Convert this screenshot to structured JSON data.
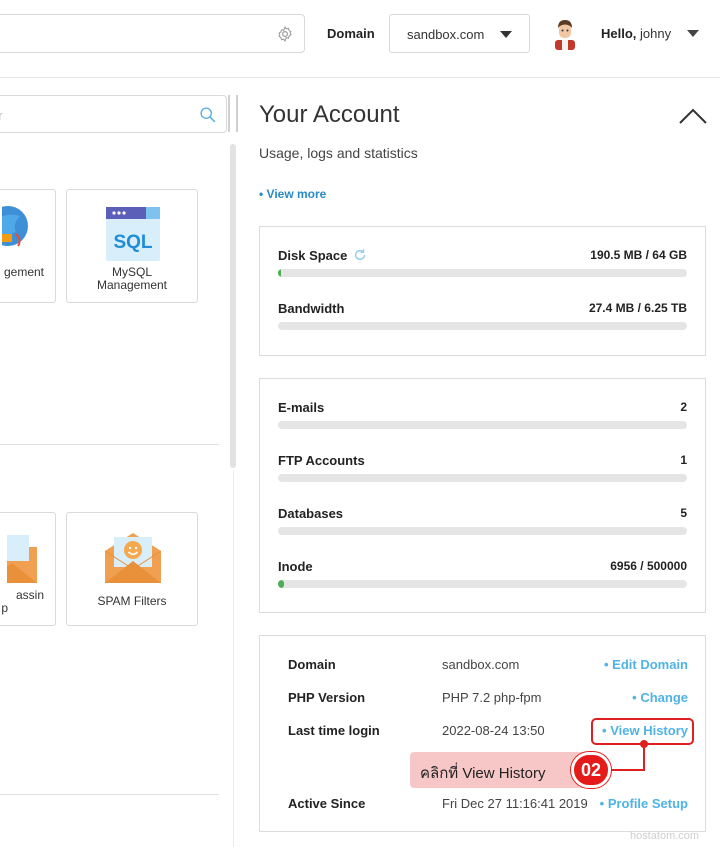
{
  "header": {
    "domain_label": "Domain",
    "domain_value": "sandbox.com",
    "hello_prefix": "Hello,",
    "username": "johny"
  },
  "left_panel": {
    "search_placeholder": "er",
    "tiles_row1": {
      "partial_label": "gement",
      "mysql_icon_text": "SQL",
      "mysql_label_line1": "MySQL",
      "mysql_label_line2": "Management"
    },
    "tiles_row2": {
      "partial_label_line1": "assin",
      "partial_label_line2": "p",
      "spam_label": "SPAM Filters"
    }
  },
  "account": {
    "title": "Your Account",
    "subtitle": "Usage, logs and statistics",
    "view_more": "• View more",
    "usage": [
      {
        "name": "Disk Space",
        "value": "190.5 MB / 64 GB",
        "fraction": 0.003
      },
      {
        "name": "Bandwidth",
        "value": "27.4 MB / 6.25 TB",
        "fraction": 0.0
      }
    ],
    "counts": [
      {
        "name": "E-mails",
        "value": "2",
        "fraction": 0.0
      },
      {
        "name": "FTP Accounts",
        "value": "1",
        "fraction": 0.0
      },
      {
        "name": "Databases",
        "value": "5",
        "fraction": 0.0
      },
      {
        "name": "Inode",
        "value": "6956 / 500000",
        "fraction": 0.014
      }
    ],
    "info": [
      {
        "key": "Domain",
        "value": "sandbox.com",
        "action": "• Edit Domain"
      },
      {
        "key": "PHP Version",
        "value": "PHP 7.2 php-fpm",
        "action": "• Change"
      },
      {
        "key": "Last time login",
        "value": "2022-08-24 13:50",
        "action": "• View History"
      },
      {
        "key": "Active Since",
        "value": "Fri Dec 27 11:16:41 2019",
        "action": "• Profile Setup"
      }
    ]
  },
  "annotation": {
    "text": "คลิกที่ View History",
    "step": "02"
  },
  "watermark": "hostatom.com",
  "colors": {
    "link": "#4fb3e6",
    "accent_red": "#e51a1a",
    "progress_fill": "#4caf50"
  }
}
